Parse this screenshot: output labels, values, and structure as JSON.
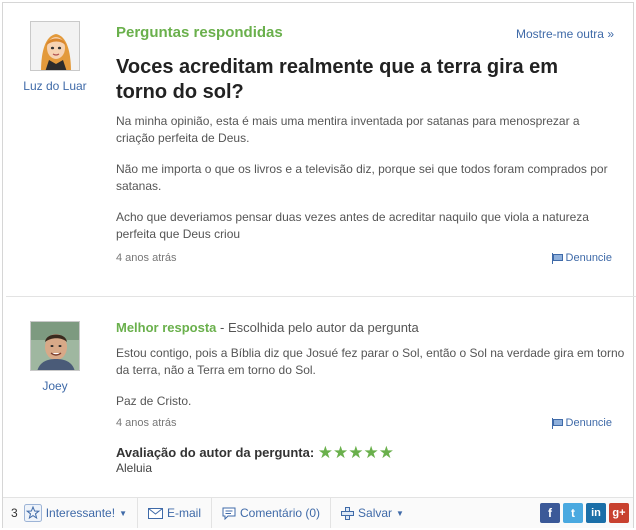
{
  "question": {
    "section_title": "Perguntas respondidas",
    "more_link": "Mostre-me outra »",
    "author": "Luz do Luar",
    "title": "Voces acreditam realmente que a terra gira em torno do sol?",
    "body": [
      "Na minha opinião, esta é mais uma mentira inventada por satanas para menosprezar a criação perfeita de Deus.",
      "Não me importa o que os livros e a televisão diz, porque sei que todos foram comprados por satanas.",
      "Acho que deveriamos pensar duas vezes antes de acreditar naquilo que viola a natureza perfeita que Deus criou"
    ],
    "time": "4 anos atrás",
    "report_label": "Denuncie"
  },
  "answer": {
    "best_label": "Melhor resposta",
    "best_suffix": " - Escolhida pelo autor da pergunta",
    "author": "Joey",
    "body": [
      "Estou contigo, pois a Bíblia diz que Josué fez parar o Sol, então o Sol na verdade gira em torno da terra, não a Terra em torno do Sol.",
      "Paz de Cristo."
    ],
    "time": "4 anos atrás",
    "report_label": "Denuncie",
    "rating_label": "Avaliação do autor da pergunta:",
    "rating_stars": "★★★★★",
    "rating_comment": "Aleluia"
  },
  "toolbar": {
    "interesting_count": "3",
    "interesting_label": "Interessante!",
    "email_label": "E-mail",
    "comment_label": "Comentário (0)",
    "save_label": "Salvar",
    "social": [
      {
        "icon": "facebook-icon",
        "glyph": "f",
        "color": "#3b5998"
      },
      {
        "icon": "twitter-icon",
        "glyph": "t",
        "color": "#4aa9e0"
      },
      {
        "icon": "linkedin-icon",
        "glyph": "in",
        "color": "#1b6fa8"
      },
      {
        "icon": "googleplus-icon",
        "glyph": "g+",
        "color": "#c8412f"
      }
    ]
  },
  "colors": {
    "accent_green": "#6ab04c",
    "link_blue": "#3f6aa8"
  }
}
